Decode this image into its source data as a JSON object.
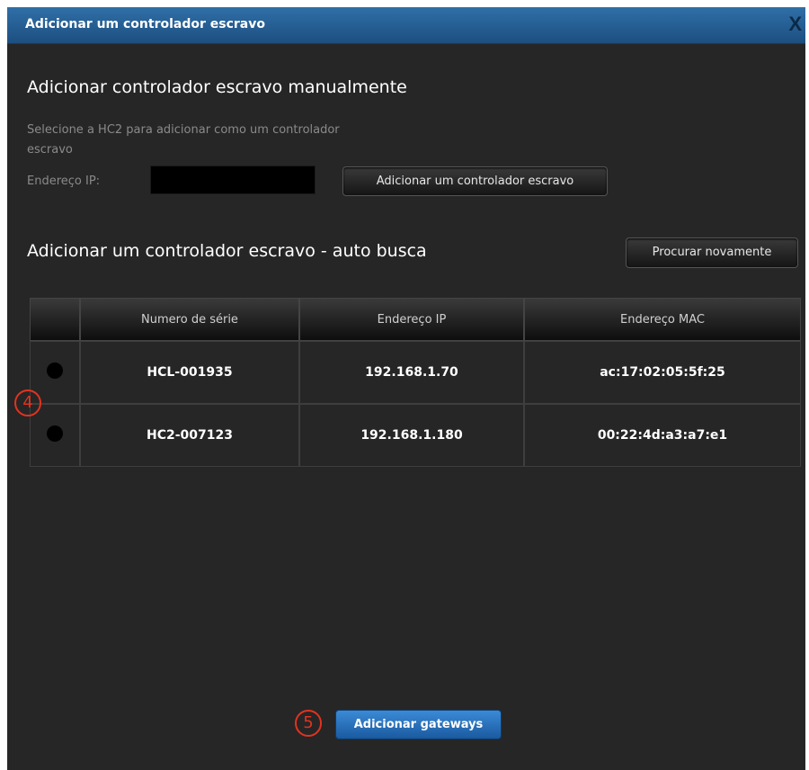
{
  "dialog": {
    "title": "Adicionar um controlador escravo",
    "close_label": "X"
  },
  "manual": {
    "heading": "Adicionar controlador escravo manualmente",
    "description": "Selecione a HC2 para adicionar como um controlador escravo",
    "ip_label": "Endereço IP:",
    "ip_value": "",
    "add_button": "Adicionar um controlador escravo"
  },
  "auto": {
    "heading": "Adicionar um controlador escravo - auto busca",
    "search_button": "Procurar novamente",
    "columns": [
      "Numero de série",
      "Endereço IP",
      "Endereço MAC"
    ],
    "rows": [
      {
        "serial": "HCL-001935",
        "ip": "192.168.1.70",
        "mac": "ac:17:02:05:5f:25"
      },
      {
        "serial": "HC2-007123",
        "ip": "192.168.1.180",
        "mac": "00:22:4d:a3:a7:e1"
      }
    ]
  },
  "markers": {
    "four": "4",
    "five": "5"
  },
  "footer": {
    "add_gateways_button": "Adicionar gateways"
  },
  "colors": {
    "title_bar": "#2a64a0",
    "background": "#262626",
    "marker": "#e2331f",
    "primary_button": "#2a72c0"
  }
}
